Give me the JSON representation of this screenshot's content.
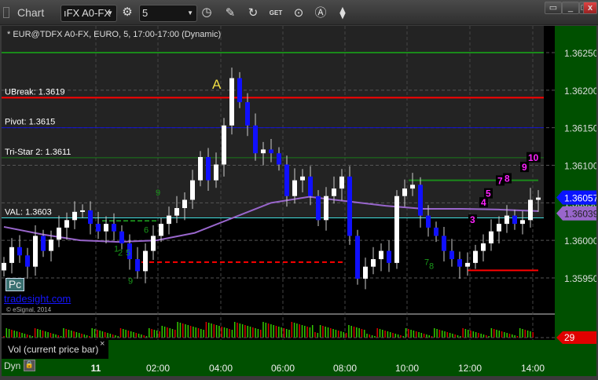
{
  "window": {
    "title": "Chart",
    "symbol": "ıFX A0-FX",
    "interval": "5"
  },
  "toolbar": {
    "icons": [
      "gear-icon",
      "clock-icon",
      "pencil-icon",
      "chart-refresh-icon",
      "get-icon",
      "play-icon",
      "alert-icon",
      "link-icon"
    ],
    "get_label": "GET"
  },
  "window_buttons": [
    "dock",
    "minimize",
    "maximize",
    "close"
  ],
  "chart": {
    "subtitle": "* EUR@TDFX A0-FX, EURO, 5, 17:00-17:00 (Dynamic)",
    "price_ticks": [
      "1.36250",
      "1.36200",
      "1.36150",
      "1.36100",
      "1.36050",
      "1.36000",
      "1.35950"
    ],
    "price_tick_values": [
      1.3625,
      1.362,
      1.3615,
      1.361,
      1.3605,
      1.36,
      1.3595
    ],
    "time_ticks": [
      "11",
      "02:00",
      "04:00",
      "06:00",
      "08:00",
      "10:00",
      "12:00",
      "14:00"
    ],
    "last_price": "1.36057",
    "ma_price": "1.36039",
    "volume_last": "29",
    "levels": [
      {
        "label": "UBreak: 1.3619",
        "value": 1.3619,
        "color": "#ff0000"
      },
      {
        "label": "Pivot: 1.3615",
        "value": 1.3615,
        "color": "#1010d0"
      },
      {
        "label": "Tri-Star 2: 1.3611",
        "value": 1.3611,
        "color": "#1a7a1a"
      },
      {
        "label": "VAL: 1.3603",
        "value": 1.3603,
        "color": "#40e0e0"
      }
    ],
    "top_level": 1.3625,
    "annotation": "A",
    "closes": [
      1.3597,
      1.35991,
      1.3598,
      1.35965,
      1.36006,
      1.35986,
      1.36001,
      1.36017,
      1.36027,
      1.36038,
      1.3604,
      1.36022,
      1.36012,
      1.36022,
      1.36012,
      1.35996,
      1.35975,
      1.35959,
      1.35986,
      1.36006,
      1.36022,
      1.36033,
      1.36043,
      1.36054,
      1.3608,
      1.36111,
      1.3608,
      1.36101,
      1.36153,
      1.36216,
      1.36184,
      1.36153,
      1.36116,
      1.36121,
      1.36116,
      1.36101,
      1.36059,
      1.3608,
      1.36085,
      1.36059,
      1.36027,
      1.36059,
      1.36069,
      1.36085,
      1.36006,
      1.35949,
      1.35965,
      1.35975,
      1.35986,
      1.3597,
      1.36059,
      1.36069,
      1.36074,
      1.36033,
      1.36017,
      1.36006,
      1.35986,
      1.35975,
      1.35965,
      1.3597,
      1.35986,
      1.35996,
      1.36012,
      1.36022,
      1.36033,
      1.36022,
      1.36027,
      1.36054,
      1.36057
    ],
    "ma": [
      1.36018,
      1.36008,
      1.36,
      1.35998,
      1.36,
      1.3601,
      1.3603,
      1.3605,
      1.36058,
      1.36052,
      1.36046,
      1.36042,
      1.36042,
      1.36041,
      1.36039
    ],
    "counts_magenta": [
      "3",
      "4",
      "5",
      "7",
      "8",
      "9",
      "10"
    ],
    "counts_green": [
      "9",
      "1",
      "2",
      "5",
      "6",
      "7",
      "8",
      "9"
    ],
    "colors": {
      "up": "#ffffff",
      "down": "#1010ff",
      "ma": "#9966cc",
      "axis_bg": "#005000",
      "last_bg": "#0a14ff",
      "ma_bg": "#9966cc",
      "vol_bg": "#e00000",
      "vol_up": "#33cc00",
      "vol_down": "#dd0000"
    }
  },
  "legend": {
    "pc": "Pc",
    "site": "tradesight.com",
    "copyright": "© eSignal, 2014"
  },
  "volume_pane": {
    "tab": "Vol (current price bar)",
    "close": "×"
  },
  "footer": {
    "dyn": "Dyn"
  }
}
